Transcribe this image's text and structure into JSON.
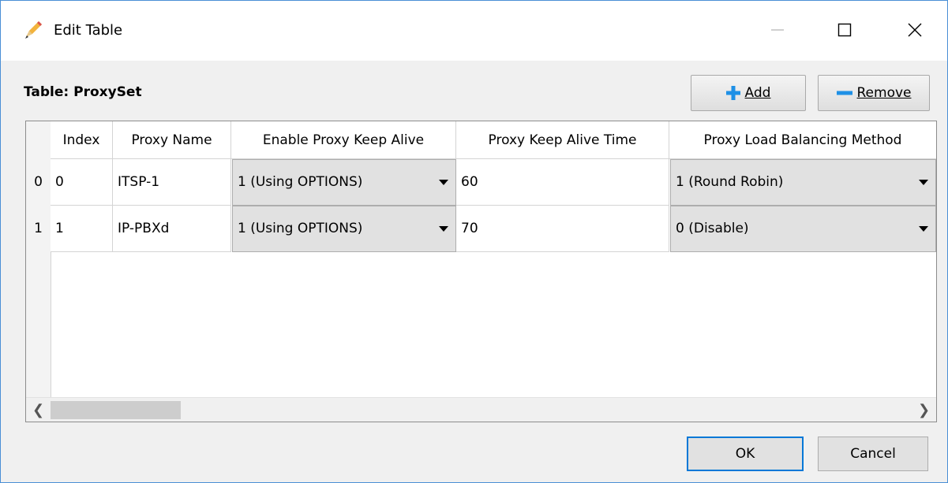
{
  "window": {
    "title": "Edit Table",
    "icon": "pencil-icon",
    "controls": [
      "minimize-icon",
      "maximize-icon",
      "close-icon"
    ]
  },
  "toolbar": {
    "table_label": "Table: ProxySet",
    "add_label": "Add",
    "remove_label": "Remove"
  },
  "grid": {
    "columns": [
      "Index",
      "Proxy Name",
      "Enable Proxy Keep Alive",
      "Proxy Keep Alive Time",
      "Proxy Load Balancing Method"
    ],
    "rows": [
      {
        "row_header": "0",
        "index": "0",
        "proxy_name": "ITSP-1",
        "keep_alive": "1 (Using OPTIONS)",
        "keep_alive_time": "60",
        "load_balancing": "1 (Round Robin)"
      },
      {
        "row_header": "1",
        "index": "1",
        "proxy_name": "IP-PBXd",
        "keep_alive": "1 (Using OPTIONS)",
        "keep_alive_time": "70",
        "load_balancing": "0 (Disable)"
      }
    ]
  },
  "footer": {
    "ok_label": "OK",
    "cancel_label": "Cancel"
  },
  "colors": {
    "accent": "#0078d7",
    "add_icon": "#1e90e6",
    "remove_icon": "#1e90e6"
  }
}
